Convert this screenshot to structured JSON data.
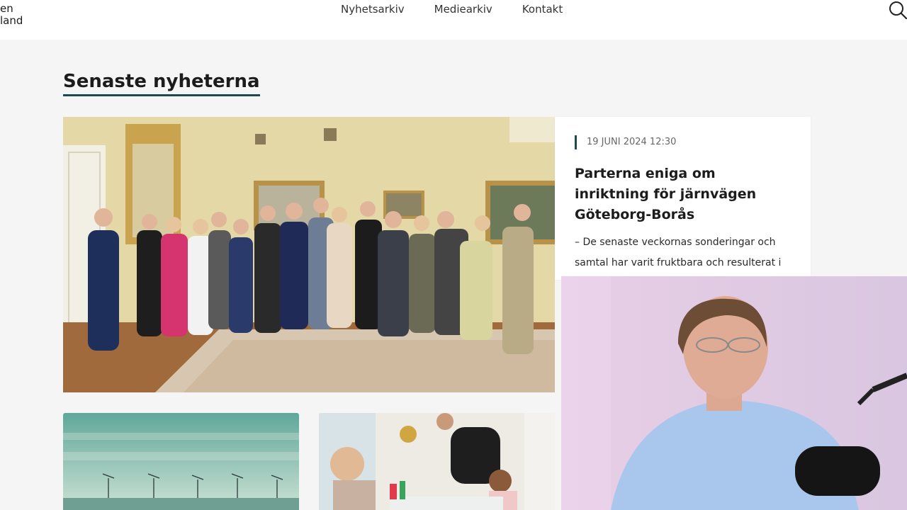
{
  "header": {
    "logo_line1": "en",
    "logo_line2": "land",
    "nav": [
      "Nyhetsarkiv",
      "Mediearkiv",
      "Kontakt"
    ]
  },
  "main": {
    "section_title": "Senaste nyheterna",
    "featured": {
      "date": "19 JUNI 2024 12:30",
      "headline": "Parterna eniga om inriktning för järnvägen Göteborg-Borås",
      "excerpt": "– De senaste veckornas sonderingar och samtal har varit fruktbara och resulterat i en gemensam sträckning för den nya järnvägen"
    }
  },
  "colors": {
    "accent": "#1d4a52",
    "background": "#f5f5f5"
  }
}
